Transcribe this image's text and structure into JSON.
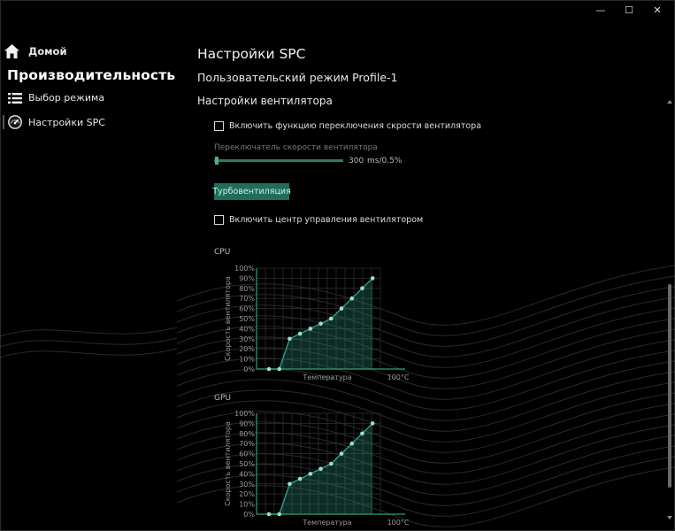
{
  "window": {
    "minimize": "—",
    "maximize": "☐",
    "close": "✕"
  },
  "sidebar": {
    "home_label": "Домой",
    "section_title": "Производительность",
    "items": [
      {
        "label": "Выбор режима",
        "icon": "list-icon"
      },
      {
        "label": "Настройки SPC",
        "icon": "gauge-icon"
      }
    ]
  },
  "main": {
    "title": "Настройки SPC",
    "profile_label": "Пользовательский режим Profile-1",
    "section_label": "Настройки вентилятора",
    "switch_option": "Включить функцию переключения скрости вентилятора",
    "slider": {
      "label": "Переключатель скорости вентилятора",
      "value": "300",
      "unit": "ms/0.5%",
      "fraction": 0.0
    },
    "turbo_button": "Турбовентиляция",
    "control_center_option": "Включить центр управления вентилятором"
  },
  "accent_color": "#2f9e84",
  "chart_data": [
    {
      "type": "line",
      "title": "CPU",
      "ylabel": "Скорость вентилятора",
      "xlabel": "Температура",
      "x_end_label": "100°C",
      "y_ticks": [
        "100%",
        "90%",
        "80%",
        "70%",
        "60%",
        "50%",
        "40%",
        "30%",
        "20%",
        "10%",
        "0%"
      ],
      "ylim": [
        0,
        100
      ],
      "x": [
        1,
        2,
        3,
        4,
        5,
        6,
        7,
        8,
        9,
        10,
        11
      ],
      "values": [
        0,
        0,
        30,
        35,
        40,
        45,
        50,
        60,
        70,
        80,
        90
      ],
      "grid": true
    },
    {
      "type": "line",
      "title": "GPU",
      "ylabel": "Скорость вентилятора",
      "xlabel": "Температура",
      "x_end_label": "100°C",
      "y_ticks": [
        "100%",
        "90%",
        "80%",
        "70%",
        "60%",
        "50%",
        "40%",
        "30%",
        "20%",
        "10%",
        "0%"
      ],
      "ylim": [
        0,
        100
      ],
      "x": [
        1,
        2,
        3,
        4,
        5,
        6,
        7,
        8,
        9,
        10,
        11
      ],
      "values": [
        0,
        0,
        30,
        35,
        40,
        45,
        50,
        60,
        70,
        80,
        90
      ],
      "grid": true
    }
  ]
}
